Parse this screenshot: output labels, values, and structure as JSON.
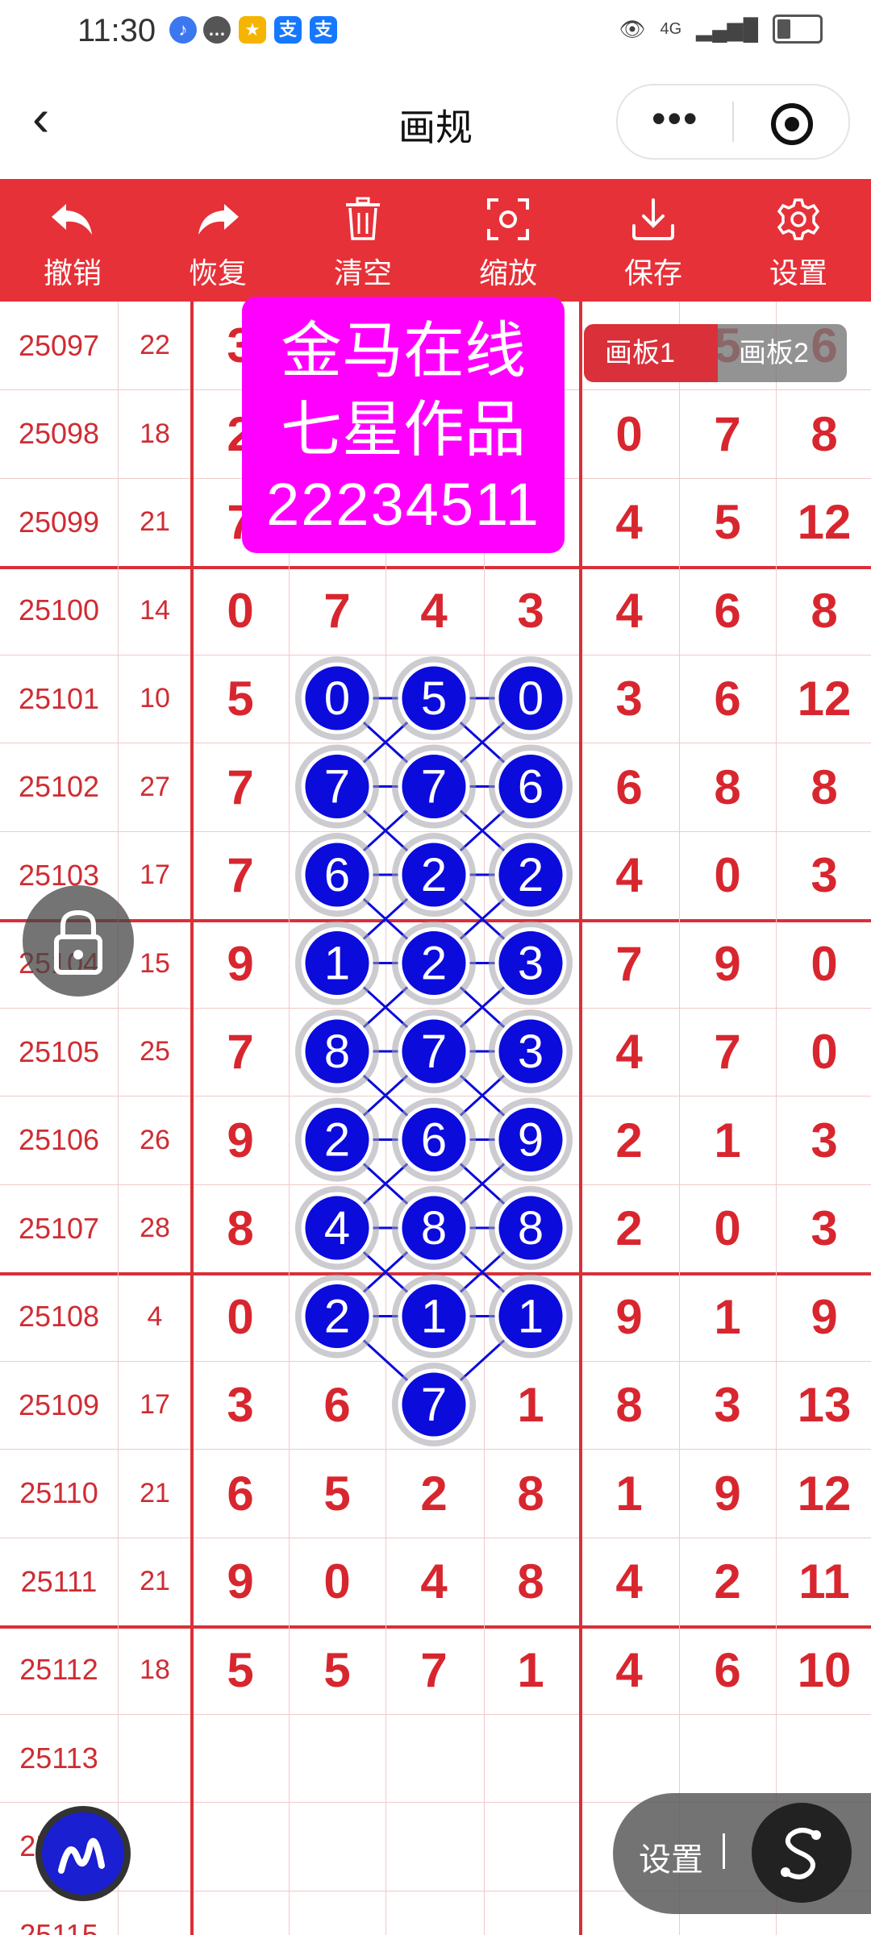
{
  "status_bar": {
    "time": "11:30",
    "network": "4G",
    "notif_a": "支",
    "notif_b": "支"
  },
  "header": {
    "title": "画规"
  },
  "toolbar": [
    {
      "label": "撤销",
      "icon": "undo-icon"
    },
    {
      "label": "恢复",
      "icon": "redo-icon"
    },
    {
      "label": "清空",
      "icon": "trash-icon"
    },
    {
      "label": "缩放",
      "icon": "zoom-icon"
    },
    {
      "label": "保存",
      "icon": "download-icon"
    },
    {
      "label": "设置",
      "icon": "gear-icon"
    }
  ],
  "overlay_card": {
    "line1": "金马在线",
    "line2": "七星作品",
    "line3": "22234511"
  },
  "boards": {
    "board1": "画板1",
    "board2": "画板2"
  },
  "rows": [
    {
      "id": "25097",
      "sum": "22",
      "d": [
        "3",
        "",
        "",
        "",
        "",
        "5",
        "6"
      ]
    },
    {
      "id": "25098",
      "sum": "18",
      "d": [
        "2",
        "",
        "",
        "",
        "0",
        "7",
        "8"
      ]
    },
    {
      "id": "25099",
      "sum": "21",
      "d": [
        "7",
        "",
        "",
        "",
        "4",
        "5",
        "12"
      ]
    },
    {
      "id": "25100",
      "sum": "14",
      "d": [
        "0",
        "7",
        "4",
        "3",
        "4",
        "6",
        "8"
      ]
    },
    {
      "id": "25101",
      "sum": "10",
      "d": [
        "5",
        "",
        "",
        "",
        "3",
        "6",
        "12"
      ]
    },
    {
      "id": "25102",
      "sum": "27",
      "d": [
        "7",
        "",
        "",
        "",
        "6",
        "8",
        "8"
      ]
    },
    {
      "id": "25103",
      "sum": "17",
      "d": [
        "7",
        "",
        "",
        "",
        "4",
        "0",
        "3"
      ]
    },
    {
      "id": "25104",
      "sum": "15",
      "d": [
        "9",
        "",
        "",
        "",
        "7",
        "9",
        "0"
      ]
    },
    {
      "id": "25105",
      "sum": "25",
      "d": [
        "7",
        "",
        "",
        "",
        "4",
        "7",
        "0"
      ]
    },
    {
      "id": "25106",
      "sum": "26",
      "d": [
        "9",
        "",
        "",
        "",
        "2",
        "1",
        "3"
      ]
    },
    {
      "id": "25107",
      "sum": "28",
      "d": [
        "8",
        "",
        "",
        "",
        "2",
        "0",
        "3"
      ]
    },
    {
      "id": "25108",
      "sum": "4",
      "d": [
        "0",
        "",
        "",
        "",
        "9",
        "1",
        "9"
      ]
    },
    {
      "id": "25109",
      "sum": "17",
      "d": [
        "3",
        "6",
        "",
        "1",
        "8",
        "3",
        "13"
      ]
    },
    {
      "id": "25110",
      "sum": "21",
      "d": [
        "6",
        "5",
        "2",
        "8",
        "1",
        "9",
        "12"
      ]
    },
    {
      "id": "25111",
      "sum": "21",
      "d": [
        "9",
        "0",
        "4",
        "8",
        "4",
        "2",
        "11"
      ]
    },
    {
      "id": "25112",
      "sum": "18",
      "d": [
        "5",
        "5",
        "7",
        "1",
        "4",
        "6",
        "10"
      ]
    },
    {
      "id": "25113",
      "sum": "",
      "d": [
        "",
        "",
        "",
        "",
        "",
        "",
        ""
      ]
    },
    {
      "id": "25114",
      "sum": "",
      "d": [
        "",
        "",
        "",
        "",
        "",
        "",
        ""
      ]
    },
    {
      "id": "25115",
      "sum": "",
      "d": [
        "",
        "",
        "",
        "",
        "",
        "",
        ""
      ]
    }
  ],
  "circles": [
    [
      "0",
      "5",
      "0"
    ],
    [
      "7",
      "7",
      "6"
    ],
    [
      "6",
      "2",
      "2"
    ],
    [
      "1",
      "2",
      "3"
    ],
    [
      "8",
      "7",
      "3"
    ],
    [
      "2",
      "6",
      "9"
    ],
    [
      "4",
      "8",
      "8"
    ],
    [
      "2",
      "1",
      "1"
    ],
    [
      "",
      "7",
      ""
    ]
  ],
  "float_bar": {
    "settings_label": "设置"
  },
  "colors": {
    "accent": "#e63138",
    "digit": "#d8262f",
    "circle": "#0b0bdc",
    "card": "#ff00ff"
  }
}
